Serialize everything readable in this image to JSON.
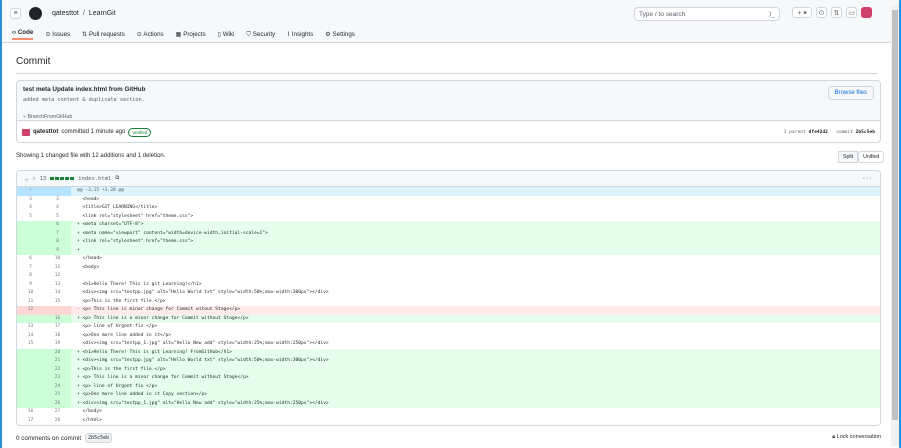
{
  "header": {
    "owner": "qatesttot",
    "repo": "LearnGit",
    "search_placeholder": "Type / to search"
  },
  "nav": [
    "Code",
    "Issues",
    "Pull requests",
    "Actions",
    "Projects",
    "Wiki",
    "Security",
    "Insights",
    "Settings"
  ],
  "page_title": "Commit",
  "commit": {
    "title": "test meta Update index.html from GitHub",
    "message": "added meta content & duplicate section.",
    "browse": "Browse files",
    "branch": "BranchFromGitHub",
    "author": "qatesttot",
    "committed": "committed 1 minute ago",
    "verified": "Verified",
    "parent_label": "1 parent",
    "parent": "dfe42d2",
    "commit_label": "commit",
    "sha": "2b5c5eb"
  },
  "summary": "Showing 1 changed file with 12 additions and 1 deletion.",
  "view": {
    "split": "Split",
    "unified": "Unified"
  },
  "file": {
    "count": "13",
    "name": "index.html",
    "more": "···"
  },
  "diff": [
    {
      "t": "hunk",
      "o": "",
      "n": "",
      "c": "@@ -3,15 +3,28 @@"
    },
    {
      "t": "ctx",
      "o": "3",
      "n": "3",
      "c": "  <head>"
    },
    {
      "t": "ctx",
      "o": "4",
      "n": "4",
      "c": "  <title>GIT LEARNING</title>"
    },
    {
      "t": "ctx",
      "o": "5",
      "n": "5",
      "c": "  <link rel=\"stylesheet\" href=\"theme.css\">"
    },
    {
      "t": "add",
      "o": "",
      "n": "6",
      "c": "+ <meta charset=\"UTF-8\">"
    },
    {
      "t": "add",
      "o": "",
      "n": "7",
      "c": "+ <meta name=\"viewport\" content=\"width=device-width,initial-scale=1\">"
    },
    {
      "t": "add",
      "o": "",
      "n": "8",
      "c": "+ <link rel=\"stylesheet\" href=\"theme.css\">"
    },
    {
      "t": "add",
      "o": "",
      "n": "9",
      "c": "+"
    },
    {
      "t": "ctx",
      "o": "6",
      "n": "10",
      "c": "  </head>"
    },
    {
      "t": "ctx",
      "o": "7",
      "n": "11",
      "c": "  <body>"
    },
    {
      "t": "ctx",
      "o": "8",
      "n": "12",
      "c": ""
    },
    {
      "t": "ctx",
      "o": "9",
      "n": "13",
      "c": "  <h1>Hello There! This is git Learning!</h1>"
    },
    {
      "t": "ctx",
      "o": "10",
      "n": "14",
      "c": "  <div><img src=\"testpp.jpg\" alt=\"Hello World txt\" style=\"width:50%;max-width:300px\"></div>"
    },
    {
      "t": "ctx",
      "o": "11",
      "n": "15",
      "c": "  <p>This is the first file.</p>"
    },
    {
      "t": "del",
      "o": "12",
      "n": "",
      "c": "- <p> This line is minor change for Commit witout Stage</p>"
    },
    {
      "t": "add",
      "o": "",
      "n": "16",
      "c": "+ <p> This line is a minor change for Commit without Stage</p>"
    },
    {
      "t": "ctx",
      "o": "13",
      "n": "17",
      "c": "  <p> line of Urgent fix </p>"
    },
    {
      "t": "ctx",
      "o": "14",
      "n": "18",
      "c": "  <p>One more line added in it</p>"
    },
    {
      "t": "ctx",
      "o": "15",
      "n": "19",
      "c": "  <div><img src=\"testpp_1.jpg\" alt=\"Hello New add\" style=\"width:25%;max-width:250px\"></div>"
    },
    {
      "t": "add",
      "o": "",
      "n": "20",
      "c": "+ <h1>Hello There! This is git Learning! FromGitHub</h1>"
    },
    {
      "t": "add",
      "o": "",
      "n": "21",
      "c": "+ <div><img src=\"testpp.jpg\" alt=\"Hello World txt\" style=\"width:50%;max-width:300px\"></div>"
    },
    {
      "t": "add",
      "o": "",
      "n": "22",
      "c": "+ <p>This is the first file.</p>"
    },
    {
      "t": "add",
      "o": "",
      "n": "23",
      "c": "+ <p> This line is a minor change for Commit without Stage</p>"
    },
    {
      "t": "add",
      "o": "",
      "n": "24",
      "c": "+ <p> line of Urgent fix </p>"
    },
    {
      "t": "add",
      "o": "",
      "n": "25",
      "c": "+ <p>One more line added in it Copy section</p>"
    },
    {
      "t": "add",
      "o": "",
      "n": "26",
      "c": "+ <div><img src=\"testpp_1.jpg\" alt=\"Hello New add\" style=\"width:25%;max-width:250px\"></div>"
    },
    {
      "t": "ctx",
      "o": "16",
      "n": "27",
      "c": "  </body>"
    },
    {
      "t": "ctx",
      "o": "17",
      "n": "28",
      "c": "  </html>"
    }
  ],
  "comments": {
    "label": "0 comments on commit",
    "sha": "2b5c5eb",
    "lock": "Lock conversation"
  }
}
